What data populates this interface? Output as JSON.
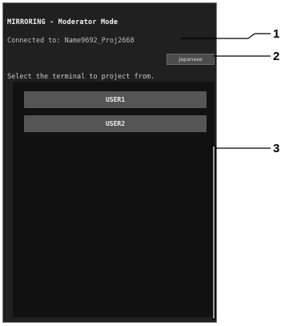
{
  "screen": {
    "title": "MIRRORING - Moderator Mode",
    "connected_text": "Connected to: Name9692_Proj2668",
    "language_button": "Japanese",
    "instruction": "Select the terminal to project from.",
    "users": [
      {
        "label": "USER1"
      },
      {
        "label": "USER2"
      }
    ]
  },
  "callouts": [
    "1",
    "2",
    "3"
  ]
}
